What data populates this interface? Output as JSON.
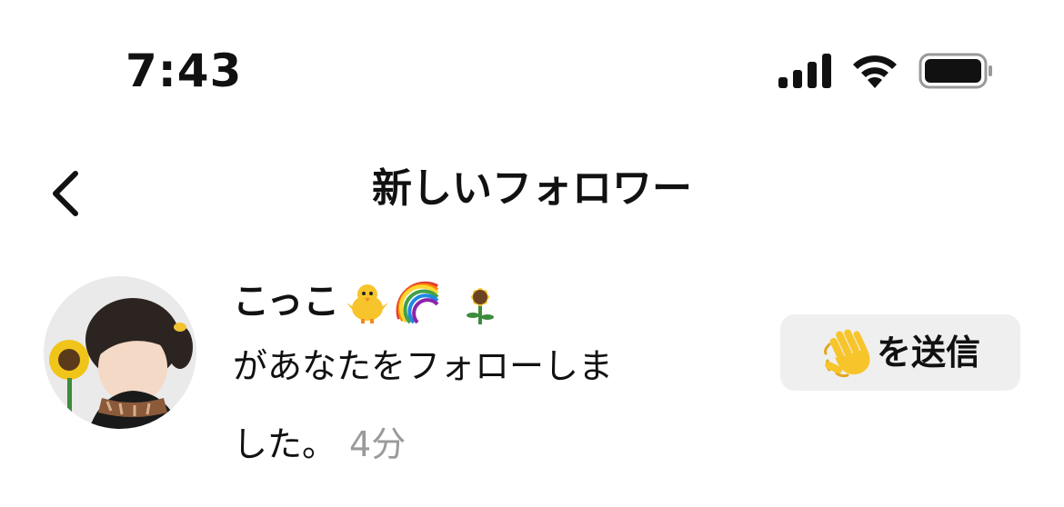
{
  "status_bar": {
    "time": "7:43",
    "icons": [
      "cellular-signal-icon",
      "wifi-icon",
      "battery-icon"
    ]
  },
  "nav": {
    "back_icon": "chevron-left-icon",
    "title": "新しいフォロワー"
  },
  "notification": {
    "avatar_icon": "profile-photo",
    "username": "こっこ",
    "username_emojis": [
      "baby-chick-icon",
      "rainbow-icon",
      "sunflower-icon"
    ],
    "message_line1": "があなたをフォローしま",
    "message_line2": "した。",
    "timestamp": "4分",
    "action_button": {
      "icon": "waving-hand-icon",
      "label": "を送信"
    }
  },
  "colors": {
    "text": "#111111",
    "secondary_text": "#9a9a9a",
    "button_bg": "#efefef"
  }
}
